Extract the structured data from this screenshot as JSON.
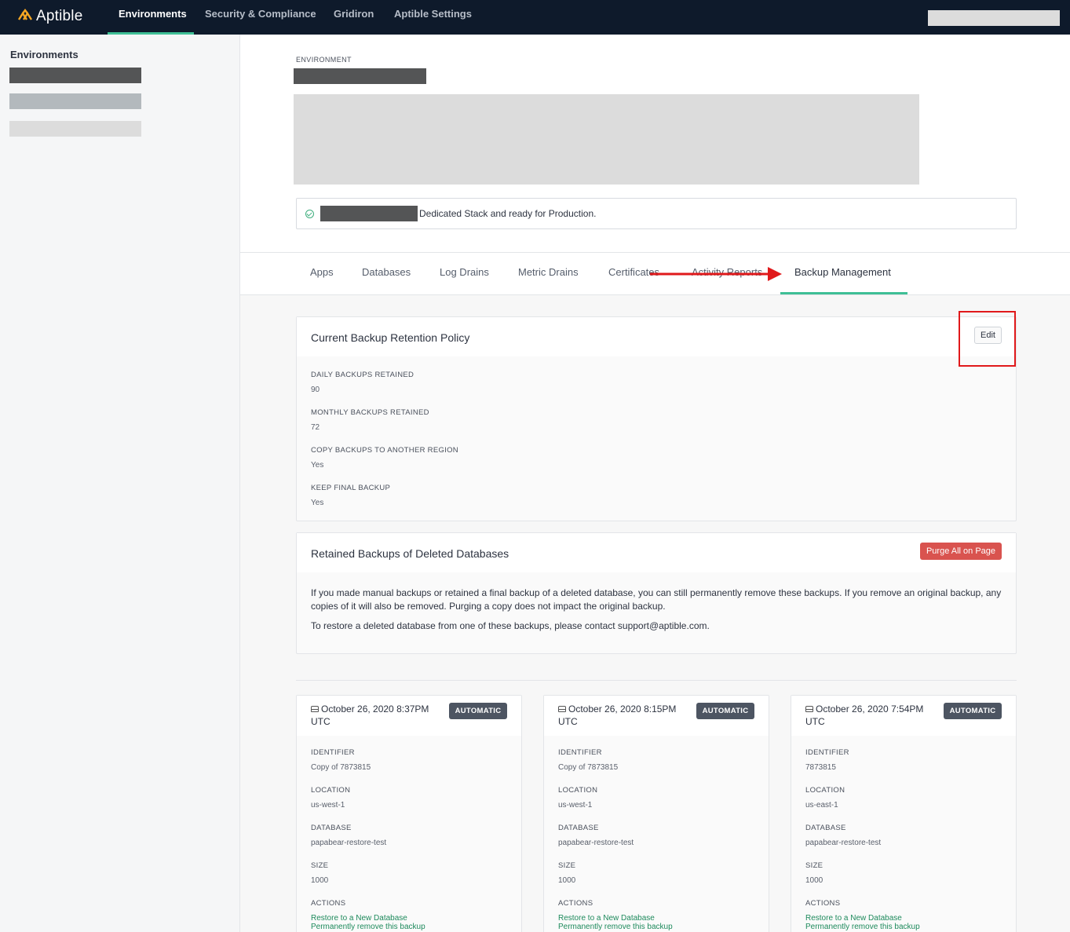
{
  "app": {
    "logo_text": "Aptible"
  },
  "nav": {
    "items": [
      "Environments",
      "Security & Compliance",
      "Gridiron",
      "Aptible Settings"
    ],
    "active": "Environments"
  },
  "sidebar": {
    "title": "Environments"
  },
  "environment": {
    "label": "ENVIRONMENT",
    "status_text": "Dedicated Stack and ready for Production."
  },
  "tabs": [
    "Apps",
    "Databases",
    "Log Drains",
    "Metric Drains",
    "Certificates",
    "Activity Reports",
    "Backup Management"
  ],
  "active_tab": "Backup Management",
  "retention_policy": {
    "title": "Current Backup Retention Policy",
    "edit_label": "Edit",
    "fields": [
      {
        "label": "DAILY BACKUPS RETAINED",
        "value": "90"
      },
      {
        "label": "MONTHLY BACKUPS RETAINED",
        "value": "72"
      },
      {
        "label": "COPY BACKUPS TO ANOTHER REGION",
        "value": "Yes"
      },
      {
        "label": "KEEP FINAL BACKUP",
        "value": "Yes"
      }
    ]
  },
  "deleted_backups": {
    "title": "Retained Backups of Deleted Databases",
    "purge_label": "Purge All on Page",
    "paragraph1": "If you made manual backups or retained a final backup of a deleted database, you can still permanently remove these backups. If you remove an original backup, any copies of it will also be removed. Purging a copy does not impact the original backup.",
    "paragraph2": "To restore a deleted database from one of these backups, please contact support@aptible.com."
  },
  "backups": [
    {
      "date": "October 26, 2020 8:37PM UTC",
      "badge": "AUTOMATIC",
      "identifier_label": "IDENTIFIER",
      "identifier": "Copy of 7873815",
      "location_label": "LOCATION",
      "location": "us-west-1",
      "database_label": "DATABASE",
      "database": "papabear-restore-test",
      "size_label": "SIZE",
      "size": "1000",
      "actions_label": "ACTIONS",
      "restore_label": "Restore to a New Database",
      "remove_label": "Permanently remove this backup"
    },
    {
      "date": "October 26, 2020 8:15PM UTC",
      "badge": "AUTOMATIC",
      "identifier_label": "IDENTIFIER",
      "identifier": "Copy of 7873815",
      "location_label": "LOCATION",
      "location": "us-west-1",
      "database_label": "DATABASE",
      "database": "papabear-restore-test",
      "size_label": "SIZE",
      "size": "1000",
      "actions_label": "ACTIONS",
      "restore_label": "Restore to a New Database",
      "remove_label": "Permanently remove this backup"
    },
    {
      "date": "October 26, 2020 7:54PM UTC",
      "badge": "AUTOMATIC",
      "identifier_label": "IDENTIFIER",
      "identifier": "7873815",
      "location_label": "LOCATION",
      "location": "us-east-1",
      "database_label": "DATABASE",
      "database": "papabear-restore-test",
      "size_label": "SIZE",
      "size": "1000",
      "actions_label": "ACTIONS",
      "restore_label": "Restore to a New Database",
      "remove_label": "Permanently remove this backup"
    }
  ],
  "colors": {
    "nav_bg": "#0e1a2b",
    "accent": "#3fbf96",
    "danger": "#d9534f",
    "annotation_red": "#e0191b",
    "link": "#1e8a5c"
  }
}
